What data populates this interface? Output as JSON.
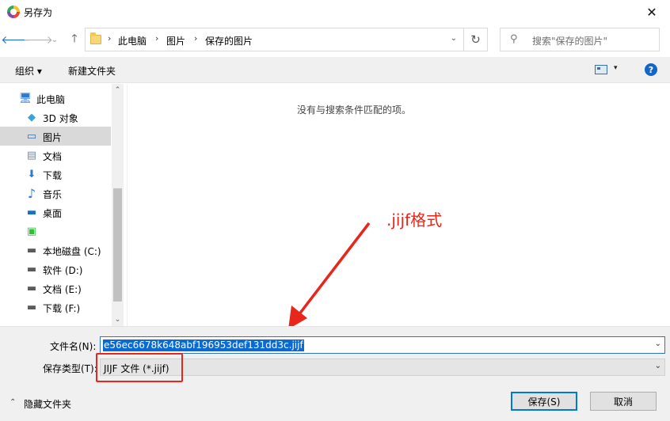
{
  "window": {
    "title": "另存为",
    "close_glyph": "✕"
  },
  "nav": {
    "back_glyph": "🡐",
    "forward_glyph": "🡒",
    "dropdown_glyph": "⌄",
    "up_glyph": "🡑",
    "breadcrumbs": [
      "此电脑",
      "图片",
      "保存的图片"
    ],
    "separator": "›",
    "address_dropdown": "⌄",
    "refresh_glyph": "↻",
    "search_placeholder": "搜索\"保存的图片\""
  },
  "toolbar": {
    "organize": "组织 ▾",
    "new_folder": "新建文件夹",
    "view_dropdown": "▾",
    "help": "?"
  },
  "sidebar": {
    "items": [
      {
        "label": "此电脑",
        "icon": "computer-icon",
        "glyph": "🖥"
      },
      {
        "label": "3D 对象",
        "icon": "cube-3d-icon",
        "glyph": "◆"
      },
      {
        "label": "图片",
        "icon": "pictures-icon",
        "glyph": "▭"
      },
      {
        "label": "文档",
        "icon": "document-icon",
        "glyph": "▤"
      },
      {
        "label": "下载",
        "icon": "download-arrow-icon",
        "glyph": "⬇"
      },
      {
        "label": "音乐",
        "icon": "music-note-icon",
        "glyph": "♪"
      },
      {
        "label": "桌面",
        "icon": "desktop-icon",
        "glyph": "▬"
      },
      {
        "label": "",
        "icon": "app-green-icon",
        "glyph": "▣"
      },
      {
        "label": "本地磁盘 (C:)",
        "icon": "drive-c-icon",
        "glyph": "▬"
      },
      {
        "label": "软件 (D:)",
        "icon": "drive-d-icon",
        "glyph": "▬"
      },
      {
        "label": "文档 (E:)",
        "icon": "drive-e-icon",
        "glyph": "▬"
      },
      {
        "label": "下载 (F:)",
        "icon": "drive-f-icon",
        "glyph": "▬"
      }
    ],
    "selected_index": 2,
    "scroll_up": "⌃",
    "scroll_down": "⌄"
  },
  "content": {
    "empty_message": "没有与搜索条件匹配的项。"
  },
  "annotation": {
    "text": ".jijf格式",
    "color": "#e8261b"
  },
  "form": {
    "filename_label": "文件名(N):",
    "filename_value": "e56ec6678k648abf196953def131dd3c.jijf",
    "filetype_label": "保存类型(T):",
    "filetype_value": "JIJF 文件 (*.jijf)",
    "dropdown_glyph": "⌄"
  },
  "footer": {
    "hide_folders": "隐藏文件夹",
    "hide_glyph": "⌃",
    "save_button": "保存(S)",
    "cancel_button": "取消"
  },
  "colors": {
    "accent": "#0078d7",
    "selection": "#0a6ad4",
    "annotation_red": "#e8261b"
  }
}
